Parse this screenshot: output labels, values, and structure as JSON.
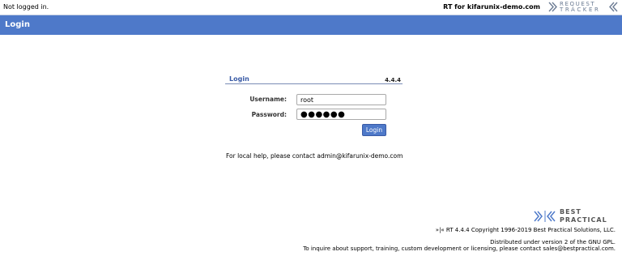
{
  "topbar": {
    "status": "Not logged in.",
    "rt_for": "RT for kifarunix-demo.com",
    "logo_line1": "REQUEST",
    "logo_line2": "TRACKER"
  },
  "header": {
    "title": "Login"
  },
  "login_panel": {
    "title": "Login",
    "version": "4.4.4",
    "username_label": "Username:",
    "username_value": "root",
    "password_label": "Password:",
    "password_value": "●●●●●●",
    "submit_label": "Login"
  },
  "help": {
    "text": "For local help, please contact admin@kifarunix-demo.com"
  },
  "footer": {
    "logo_line1": "BEST",
    "logo_line2": "PRACTICAL",
    "copyright": "»|« RT 4.4.4 Copyright 1996-2019 Best Practical Solutions, LLC.",
    "license": "Distributed under version 2 of the GNU GPL.",
    "inquire": "To inquire about support, training, custom development or licensing, please contact sales@bestpractical.com."
  },
  "colors": {
    "accent": "#4e79c9",
    "title_blue": "#3a5ba6",
    "logo_grey": "#6b7b93"
  }
}
